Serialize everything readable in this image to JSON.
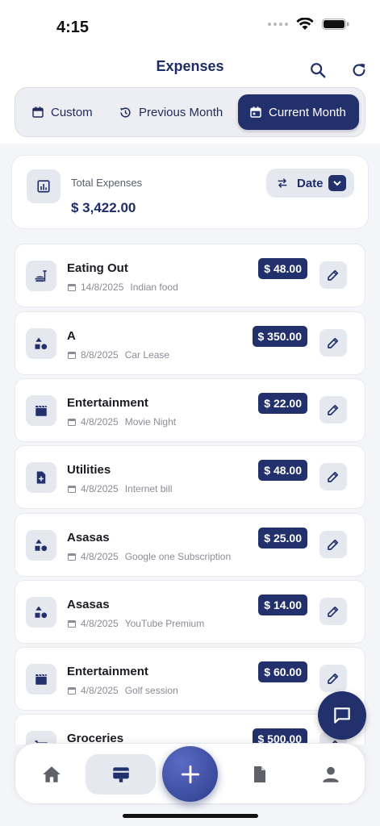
{
  "status": {
    "time": "4:15"
  },
  "appbar": {
    "title": "Expenses"
  },
  "filters": [
    {
      "label": "Custom",
      "icon": "calendar-icon",
      "active": false
    },
    {
      "label": "Previous Month",
      "icon": "history-icon",
      "active": false
    },
    {
      "label": "Current Month",
      "icon": "calendar-icon",
      "active": true
    }
  ],
  "summary": {
    "label": "Total Expenses",
    "amount": "$ 3,422.00",
    "sort_label": "Date"
  },
  "expenses": [
    {
      "title": "Eating Out",
      "date": "14/8/2025",
      "note": "Indian food",
      "amount": "$ 48.00",
      "icon": "fastfood-icon"
    },
    {
      "title": "A",
      "date": "8/8/2025",
      "note": "Car Lease",
      "amount": "$ 350.00",
      "icon": "category-shapes-icon"
    },
    {
      "title": "Entertainment",
      "date": "4/8/2025",
      "note": "Movie Night",
      "amount": "$ 22.00",
      "icon": "clapperboard-icon"
    },
    {
      "title": "Utilities",
      "date": "4/8/2025",
      "note": "Internet bill",
      "amount": "$ 48.00",
      "icon": "bill-icon"
    },
    {
      "title": "Asasas",
      "date": "4/8/2025",
      "note": "Google one Subscription",
      "amount": "$ 25.00",
      "icon": "category-shapes-icon"
    },
    {
      "title": "Asasas",
      "date": "4/8/2025",
      "note": "YouTube Premium",
      "amount": "$ 14.00",
      "icon": "category-shapes-icon"
    },
    {
      "title": "Entertainment",
      "date": "4/8/2025",
      "note": "Golf session",
      "amount": "$ 60.00",
      "icon": "clapperboard-icon"
    },
    {
      "title": "Groceries",
      "date": "",
      "note": "",
      "amount": "$ 500.00",
      "icon": "cart-icon"
    }
  ],
  "nav": [
    {
      "icon": "home-icon",
      "active": false
    },
    {
      "icon": "wallet-icon",
      "active": true
    },
    {
      "icon": "add-icon",
      "active": false
    },
    {
      "icon": "document-icon",
      "active": false
    },
    {
      "icon": "person-icon",
      "active": false
    }
  ],
  "colors": {
    "primary": "#22306b",
    "surface": "#e6e8ef",
    "background": "#f4f5f8"
  }
}
